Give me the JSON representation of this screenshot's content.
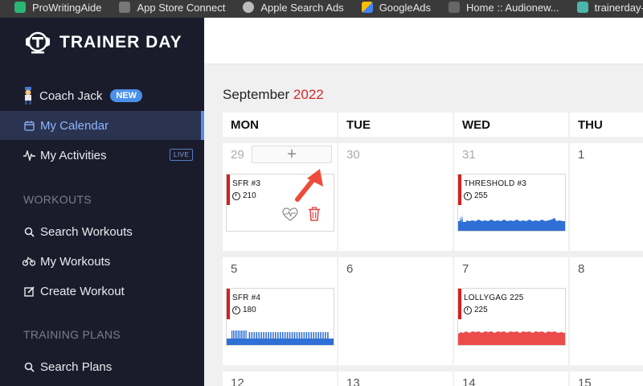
{
  "bookmarks": [
    {
      "label": "ProWritingAide",
      "color": "#2bb673",
      "icon": "bookmark-icon"
    },
    {
      "label": "App Store Connect",
      "color": "#777777",
      "icon": "apple-icon"
    },
    {
      "label": "Apple Search Ads",
      "color": "#bbbbbb",
      "icon": "apple-icon"
    },
    {
      "label": "GoogleAds",
      "color": "#fbbc04",
      "icon": "google-ads-icon"
    },
    {
      "label": "Home :: Audionew...",
      "color": "#666666",
      "icon": "bookmark-icon"
    },
    {
      "label": "trainerday-realti...",
      "color": "#4db6ac",
      "icon": "bookmark-icon"
    }
  ],
  "brand": {
    "name": "TRAINER DAY"
  },
  "nav": {
    "coach": {
      "label": "Coach Jack",
      "badge": "NEW"
    },
    "calendar": {
      "label": "My Calendar"
    },
    "activities": {
      "label": "My Activities",
      "badge": "LIVE"
    }
  },
  "sections": {
    "workouts": {
      "heading": "WORKOUTS",
      "items": [
        "Search Workouts",
        "My Workouts",
        "Create Workout"
      ]
    },
    "plans": {
      "heading": "TRAINING PLANS",
      "items": [
        "Search Plans"
      ]
    }
  },
  "calendar": {
    "month": "September",
    "year": "2022",
    "weekdays": [
      "MON",
      "TUE",
      "WED",
      "THU"
    ],
    "week1": [
      "29",
      "30",
      "31",
      "1"
    ],
    "week2": [
      "5",
      "6",
      "7",
      "8"
    ],
    "week3": [
      "12",
      "13",
      "14",
      "15"
    ],
    "add_label": "+"
  },
  "workouts": {
    "sfr3": {
      "title": "SFR #3",
      "tss": "210"
    },
    "threshold3": {
      "title": "THRESHOLD #3",
      "tss": "255"
    },
    "sfr4": {
      "title": "SFR #4",
      "tss": "180"
    },
    "lollygag": {
      "title": "LOLLYGAG 225",
      "tss": "225"
    }
  },
  "colors": {
    "accent": "#d62020",
    "profile_blue": "#2f6fd6",
    "profile_red": "#ec4b4b",
    "sidebar_bg": "#1b1c2b",
    "active_blue": "#8fb6ff"
  }
}
